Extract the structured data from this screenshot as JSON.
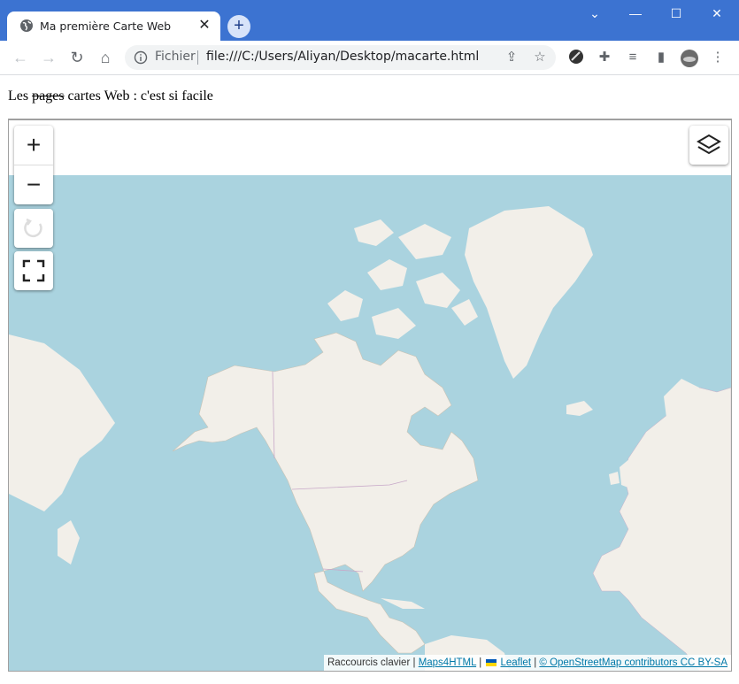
{
  "browser": {
    "tab_title": "Ma première Carte Web",
    "scheme_label": "Fichier",
    "url": "file:///C:/Users/Aliyan/Desktop/macarte.html"
  },
  "page": {
    "heading_prefix": "Les ",
    "heading_strike": "pages",
    "heading_suffix": " cartes Web : c'est si facile"
  },
  "map": {
    "controls": {
      "zoom_in": "+",
      "zoom_out": "−"
    },
    "attribution": {
      "shortcuts": "Raccourcis clavier",
      "sep": " | ",
      "maps4html": "Maps4HTML",
      "leaflet": "Leaflet",
      "osm": "© OpenStreetMap contributors CC BY-SA"
    },
    "colors": {
      "water": "#aad3df",
      "land": "#f2efe9",
      "border": "#c8a8c8"
    }
  },
  "colors": {
    "titlebar": "#3c73d1",
    "link": "#0078a8"
  }
}
